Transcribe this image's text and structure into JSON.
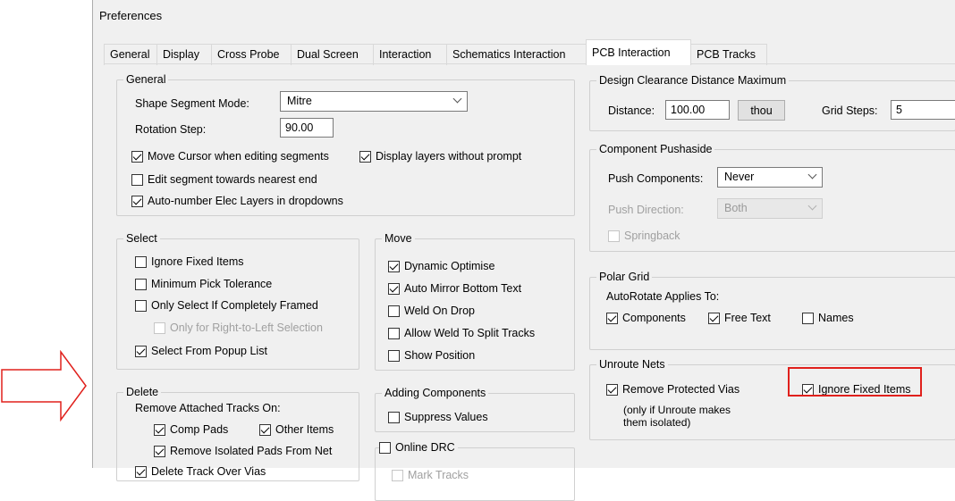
{
  "window": {
    "title": "Preferences"
  },
  "tabs": [
    "General",
    "Display",
    "Cross Probe",
    "Dual Screen",
    "Interaction",
    "Schematics Interaction",
    "PCB Interaction",
    "PCB Tracks"
  ],
  "general": {
    "legend": "General",
    "shape_segment_mode_label": "Shape Segment Mode:",
    "shape_segment_mode_value": "Mitre",
    "rotation_step_label": "Rotation Step:",
    "rotation_step_value": "90.00",
    "move_cursor": "Move Cursor when editing segments",
    "display_layers": "Display layers without prompt",
    "edit_segment": "Edit segment towards nearest end",
    "auto_number": "Auto-number Elec Layers in dropdowns"
  },
  "select": {
    "legend": "Select",
    "ignore_fixed": "Ignore Fixed Items",
    "min_pick": "Minimum Pick Tolerance",
    "only_select": "Only Select If Completely Framed",
    "only_right_left": "Only for Right-to-Left Selection",
    "select_popup": "Select From Popup List"
  },
  "move": {
    "legend": "Move",
    "dynamic_optimise": "Dynamic Optimise",
    "auto_mirror": "Auto Mirror Bottom Text",
    "weld_on_drop": "Weld On Drop",
    "allow_weld": "Allow Weld To Split Tracks",
    "show_position": "Show Position"
  },
  "delete": {
    "legend": "Delete",
    "remove_attached": "Remove Attached Tracks On:",
    "comp_pads": "Comp Pads",
    "other_items": "Other Items",
    "remove_isolated": "Remove Isolated Pads From Net",
    "cut_text": "Delete Track Over Vias"
  },
  "adding": {
    "legend": "Adding Components",
    "suppress_values": "Suppress Values"
  },
  "online_drc": {
    "legend": "Online DRC",
    "cut_text": "Mark Tracks"
  },
  "clearance": {
    "legend": "Design Clearance Distance Maximum",
    "distance_label": "Distance:",
    "distance_value": "100.00",
    "unit_button": "thou",
    "grid_steps_label": "Grid Steps:",
    "grid_steps_value": "5"
  },
  "pushaside": {
    "legend": "Component Pushaside",
    "push_label": "Push Components:",
    "push_value": "Never",
    "direction_label": "Push Direction:",
    "direction_value": "Both",
    "springback": "Springback"
  },
  "polar": {
    "legend": "Polar Grid",
    "autorotate": "AutoRotate Applies To:",
    "components": "Components",
    "free_text": "Free Text",
    "names": "Names"
  },
  "unroute": {
    "legend": "Unroute Nets",
    "remove_vias": "Remove Protected Vias",
    "note_line1": "(only if Unroute makes",
    "note_line2": "them isolated)",
    "ignore_fixed": "Ignore Fixed Items"
  },
  "colors": {
    "highlight": "#e0201c",
    "arrow": "#e0201c",
    "window_bg": "#f0f0f0"
  }
}
